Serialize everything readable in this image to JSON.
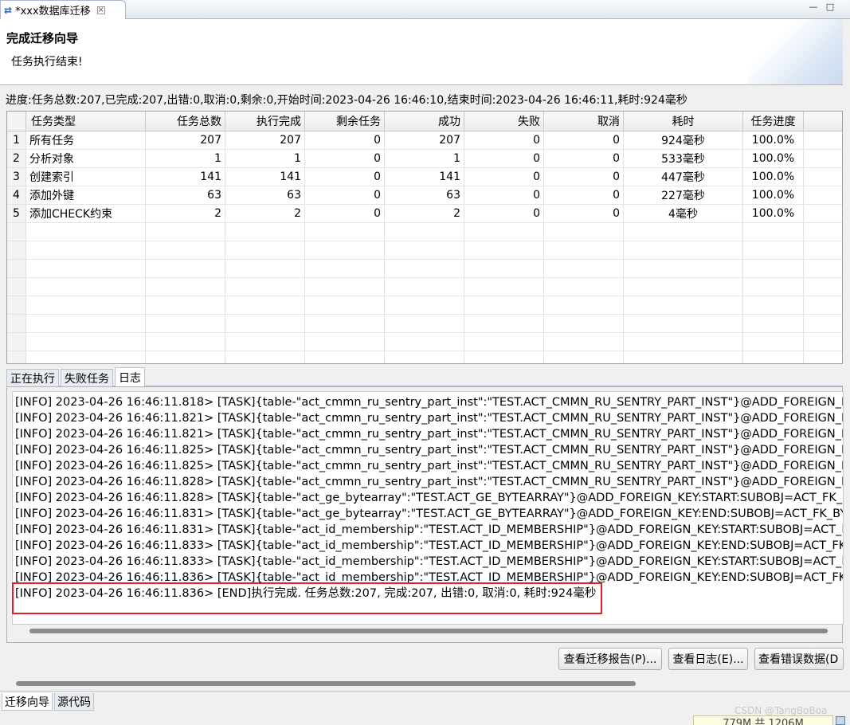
{
  "editor_tab": {
    "title": "*xxx数据库迁移",
    "close": "×"
  },
  "window_buttons": {
    "minimize": "—",
    "maximize": "□"
  },
  "wizard": {
    "title": "完成迁移向导",
    "message": "任务执行结束!"
  },
  "progress_text": "进度:任务总数:207,已完成:207,出错:0,取消:0,剩余:0,开始时间:2023-04-26 16:46:10,结束时间:2023-04-26 16:46:11,耗时:924毫秒",
  "table": {
    "columns": [
      "任务类型",
      "任务总数",
      "执行完成",
      "剩余任务",
      "成功",
      "失败",
      "取消",
      "耗时",
      "任务进度"
    ],
    "rows": [
      {
        "num": "1",
        "type": "所有任务",
        "total": "207",
        "done": "207",
        "remaining": "0",
        "success": "207",
        "failed": "0",
        "cancelled": "0",
        "elapsed": "924毫秒",
        "progress": "100.0%"
      },
      {
        "num": "2",
        "type": "分析对象",
        "total": "1",
        "done": "1",
        "remaining": "0",
        "success": "1",
        "failed": "0",
        "cancelled": "0",
        "elapsed": "533毫秒",
        "progress": "100.0%"
      },
      {
        "num": "3",
        "type": "创建索引",
        "total": "141",
        "done": "141",
        "remaining": "0",
        "success": "141",
        "failed": "0",
        "cancelled": "0",
        "elapsed": "447毫秒",
        "progress": "100.0%"
      },
      {
        "num": "4",
        "type": "添加外键",
        "total": "63",
        "done": "63",
        "remaining": "0",
        "success": "63",
        "failed": "0",
        "cancelled": "0",
        "elapsed": "227毫秒",
        "progress": "100.0%"
      },
      {
        "num": "5",
        "type": "添加CHECK约束",
        "total": "2",
        "done": "2",
        "remaining": "0",
        "success": "2",
        "failed": "0",
        "cancelled": "0",
        "elapsed": "4毫秒",
        "progress": "100.0%"
      }
    ]
  },
  "panel_tabs": [
    "正在执行",
    "失败任务",
    "日志"
  ],
  "log_lines": [
    "[INFO] 2023-04-26 16:46:11.818> [TASK]{table-\"act_cmmn_ru_sentry_part_inst\":\"TEST.ACT_CMMN_RU_SENTRY_PART_INST\"}@ADD_FOREIGN_K",
    "[INFO] 2023-04-26 16:46:11.821> [TASK]{table-\"act_cmmn_ru_sentry_part_inst\":\"TEST.ACT_CMMN_RU_SENTRY_PART_INST\"}@ADD_FOREIGN_K",
    "[INFO] 2023-04-26 16:46:11.821> [TASK]{table-\"act_cmmn_ru_sentry_part_inst\":\"TEST.ACT_CMMN_RU_SENTRY_PART_INST\"}@ADD_FOREIGN_K",
    "[INFO] 2023-04-26 16:46:11.825> [TASK]{table-\"act_cmmn_ru_sentry_part_inst\":\"TEST.ACT_CMMN_RU_SENTRY_PART_INST\"}@ADD_FOREIGN_K",
    "[INFO] 2023-04-26 16:46:11.825> [TASK]{table-\"act_cmmn_ru_sentry_part_inst\":\"TEST.ACT_CMMN_RU_SENTRY_PART_INST\"}@ADD_FOREIGN_K",
    "[INFO] 2023-04-26 16:46:11.828> [TASK]{table-\"act_cmmn_ru_sentry_part_inst\":\"TEST.ACT_CMMN_RU_SENTRY_PART_INST\"}@ADD_FOREIGN_K",
    "[INFO] 2023-04-26 16:46:11.828> [TASK]{table-\"act_ge_bytearray\":\"TEST.ACT_GE_BYTEARRAY\"}@ADD_FOREIGN_KEY:START:SUBOBJ=ACT_FK_B",
    "[INFO] 2023-04-26 16:46:11.831> [TASK]{table-\"act_ge_bytearray\":\"TEST.ACT_GE_BYTEARRAY\"}@ADD_FOREIGN_KEY:END:SUBOBJ=ACT_FK_BYT",
    "[INFO] 2023-04-26 16:46:11.831> [TASK]{table-\"act_id_membership\":\"TEST.ACT_ID_MEMBERSHIP\"}@ADD_FOREIGN_KEY:START:SUBOBJ=ACT_F",
    "[INFO] 2023-04-26 16:46:11.833> [TASK]{table-\"act_id_membership\":\"TEST.ACT_ID_MEMBERSHIP\"}@ADD_FOREIGN_KEY:END:SUBOBJ=ACT_FK_",
    "[INFO] 2023-04-26 16:46:11.833> [TASK]{table-\"act_id_membership\":\"TEST.ACT_ID_MEMBERSHIP\"}@ADD_FOREIGN_KEY:START:SUBOBJ=ACT_F",
    "[INFO] 2023-04-26 16:46:11.836> [TASK]{table-\"act_id_membership\":\"TEST.ACT_ID_MEMBERSHIP\"}@ADD_FOREIGN_KEY:END:SUBOBJ=ACT_FK_",
    "[INFO] 2023-04-26 16:46:11.836> [END]执行完成. 任务总数:207, 完成:207, 出错:0, 取消:0, 耗时:924毫秒"
  ],
  "buttons": {
    "view_report": "查看迁移报告(P)...",
    "view_log": "查看日志(E)...",
    "view_errors": "查看错误数据(D"
  },
  "editor_bottom_tabs": [
    "迁移向导",
    "源代码"
  ],
  "status_bar": {
    "memory": "779M 共 1206M",
    "watermark": "CSDN @TangBoBoa"
  },
  "colors": {
    "highlight_border": "#e0202a"
  }
}
